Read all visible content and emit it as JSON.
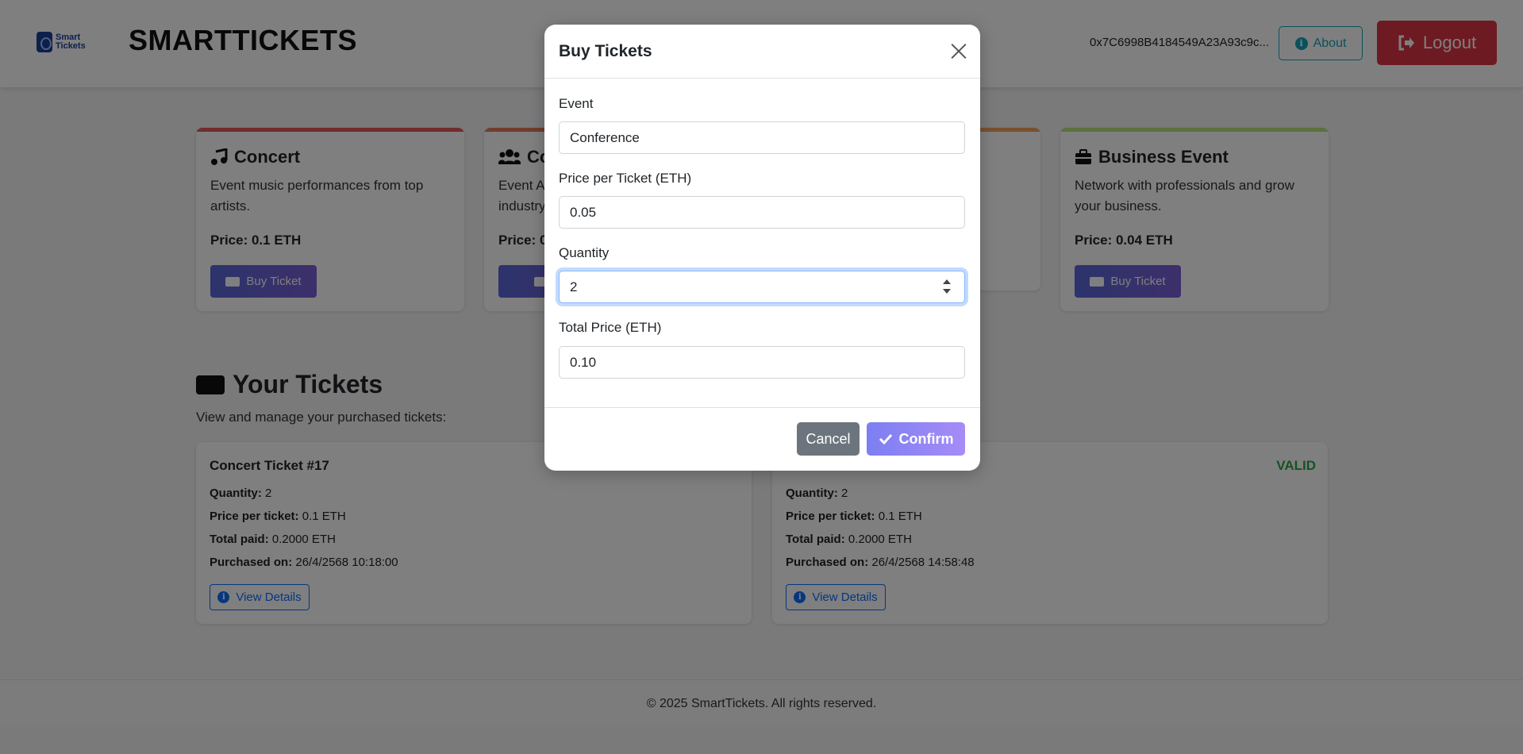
{
  "header": {
    "logo_text_line1": "Smart",
    "logo_text_line2": "Tickets",
    "brand": "SMARTTICKETS",
    "wallet_address": "0x7C6998B4184549A23A93c9c...",
    "about_label": "About",
    "logout_label": "Logout"
  },
  "events": [
    {
      "title": "Concert",
      "icon": "music-icon",
      "description": "Event music performances from top artists.",
      "price": "Price: 0.1 ETH",
      "button": "Buy Ticket",
      "accent": "#e05a5a"
    },
    {
      "title": "Co",
      "icon": "users-icon",
      "description": "Event A industry",
      "price": "Price: 0",
      "button": "Bu",
      "accent": "#e07a5a"
    },
    {
      "title": "",
      "icon": "",
      "description": "",
      "price": "",
      "button": "",
      "accent": "#f0a060"
    },
    {
      "title": "Business Event",
      "icon": "briefcase-icon",
      "description": "Network with professionals and grow your business.",
      "price": "Price: 0.04 ETH",
      "button": "Buy Ticket",
      "accent": "#b8e07a"
    }
  ],
  "your_tickets": {
    "title": "Your Tickets",
    "subtitle": "View and manage your purchased tickets:",
    "tickets": [
      {
        "name": "Concert Ticket #17",
        "status": "",
        "quantity_label": "Quantity:",
        "quantity": "2",
        "price_label": "Price per ticket:",
        "price": "0.1 ETH",
        "total_label": "Total paid:",
        "total": "0.2000 ETH",
        "purchased_label": "Purchased on:",
        "purchased": "26/4/2568 10:18:00",
        "button": "View Details"
      },
      {
        "name": "",
        "status": "VALID",
        "quantity_label": "Quantity:",
        "quantity": "2",
        "price_label": "Price per ticket:",
        "price": "0.1 ETH",
        "total_label": "Total paid:",
        "total": "0.2000 ETH",
        "purchased_label": "Purchased on:",
        "purchased": "26/4/2568 14:58:48",
        "button": "View Details"
      }
    ]
  },
  "footer": {
    "text": "© 2025 SmartTickets. All rights reserved."
  },
  "modal": {
    "title": "Buy Tickets",
    "event_label": "Event",
    "event_value": "Conference",
    "price_label": "Price per Ticket (ETH)",
    "price_value": "0.05",
    "quantity_label": "Quantity",
    "quantity_value": "2",
    "total_label": "Total Price (ETH)",
    "total_value": "0.10",
    "cancel_label": "Cancel",
    "confirm_label": "Confirm"
  },
  "colors": {
    "accent": "#5a67d8",
    "danger": "#dc3545",
    "info": "#17a2b8",
    "success": "#28a745"
  }
}
